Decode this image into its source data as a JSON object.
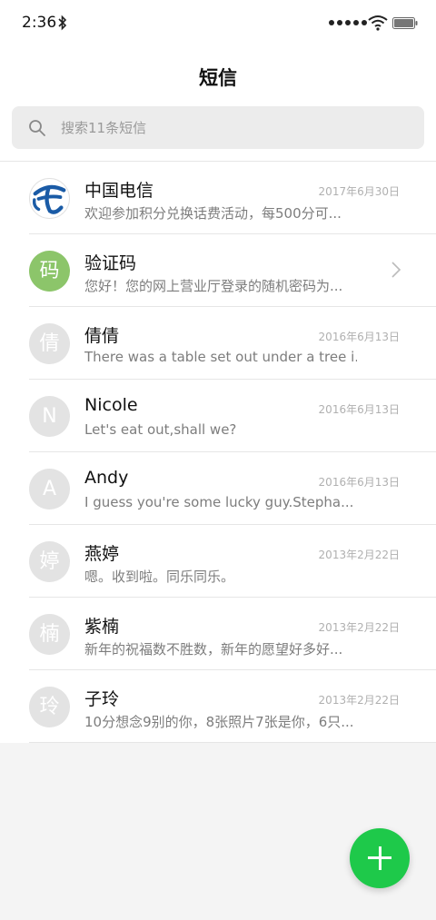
{
  "status_bar": {
    "time": "2:36",
    "icons": [
      "bluetooth-icon",
      "signal-icon",
      "wifi-icon",
      "battery-icon"
    ]
  },
  "header": {
    "title": "短信"
  },
  "search": {
    "placeholder": "搜索11条短信"
  },
  "messages": [
    {
      "name": "中国电信",
      "preview": "欢迎参加积分兑换话费活动，每500分可...",
      "date": "2017年6月30日",
      "avatar_type": "logo",
      "avatar_text": ""
    },
    {
      "name": "验证码",
      "preview": "您好！您的网上营业厅登录的随机密码为...",
      "date": "",
      "avatar_type": "green",
      "avatar_text": "码"
    },
    {
      "name": "倩倩",
      "preview": "There was a table set out under a tree i...",
      "date": "2016年6月13日",
      "avatar_type": "grey",
      "avatar_text": "倩"
    },
    {
      "name": "Nicole",
      "preview": "Let's eat out,shall we?",
      "date": "2016年6月13日",
      "avatar_type": "grey",
      "avatar_text": "N"
    },
    {
      "name": "Andy",
      "preview": "I guess you're some lucky guy.Stepha...",
      "date": "2016年6月13日",
      "avatar_type": "grey",
      "avatar_text": "A"
    },
    {
      "name": "燕婷",
      "preview": "嗯。收到啦。同乐同乐。",
      "date": "2013年2月22日",
      "avatar_type": "grey",
      "avatar_text": "婷"
    },
    {
      "name": "紫楠",
      "preview": "新年的祝福数不胜数，新年的愿望好多好...",
      "date": "2013年2月22日",
      "avatar_type": "grey",
      "avatar_text": "楠"
    },
    {
      "name": "子玲",
      "preview": "10分想念9别的你，8张照片7张是你，6只...",
      "date": "2013年2月22日",
      "avatar_type": "grey",
      "avatar_text": "玲"
    }
  ],
  "colors": {
    "accent_green": "#1ec94a",
    "avatar_green": "#8cc56a",
    "avatar_grey": "#e3e3e3",
    "telecom_blue": "#1a5ba6"
  },
  "fab": {
    "icon": "plus-icon"
  }
}
